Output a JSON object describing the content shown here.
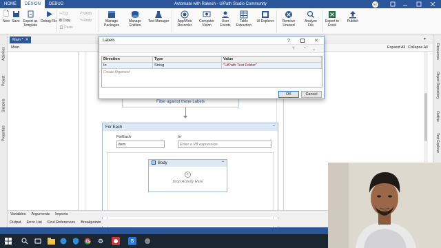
{
  "titlebar": {
    "tabs": [
      "HOME",
      "DESIGN",
      "DEBUG"
    ],
    "active_tab": "DESIGN",
    "title": "Automate with Rakesh - UiPath Studio Community",
    "avatar": "RK"
  },
  "ribbon": {
    "new": "New",
    "save": "Save",
    "export_template": "Export as Template",
    "debug_file": "Debug File",
    "cut": "Cut",
    "copy": "Copy",
    "paste": "Paste",
    "undo": "Undo",
    "redo": "Redo",
    "manage_packages": "Manage Packages",
    "manage_entities": "Manage Entities",
    "test_manager": "Test Manager",
    "app_web_recorder": "App/Web Recorder",
    "computer_vision": "Computer Vision",
    "user_events": "User Events",
    "table_extraction": "Table Extraction",
    "ui_explorer": "UI Explorer",
    "remove_unused": "Remove Unused",
    "analyze_file": "Analyze File",
    "export_excel": "Export to Excel",
    "publish": "Publish"
  },
  "left_panels": [
    "Activities",
    "Project",
    "Snippets",
    "Properties"
  ],
  "right_panels": [
    "Resources",
    "Object Repository",
    "Outline",
    "Test Explorer"
  ],
  "doc": {
    "tab": "Main *",
    "breadcrumb": "Main",
    "expand_all": "Expand All",
    "collapse_all": "Collapse All"
  },
  "designer": {
    "filter_activity": "Filter against these Labels",
    "foreach_title": "For Each",
    "foreach_label": "ForEach",
    "in_label": "In",
    "item_value": "item",
    "in_placeholder": "Enter a VB expression",
    "body_title": "Body",
    "drop_hint": "Drop Activity Here"
  },
  "bottom_tabs": [
    "Variables",
    "Arguments",
    "Imports"
  ],
  "output_tabs": [
    "Output",
    "Error List",
    "Find References",
    "Breakpoints"
  ],
  "dialog": {
    "title": "Labels",
    "help": "?",
    "columns": [
      "Direction",
      "Type",
      "Value"
    ],
    "row": {
      "direction": "In",
      "type": "String",
      "value": "\"UiPath Test Folder\""
    },
    "create_argument": "Create Argument",
    "ok": "OK",
    "cancel": "Cancel"
  },
  "colors": {
    "accent": "#2b579a",
    "taskbar": "#1b2633"
  }
}
